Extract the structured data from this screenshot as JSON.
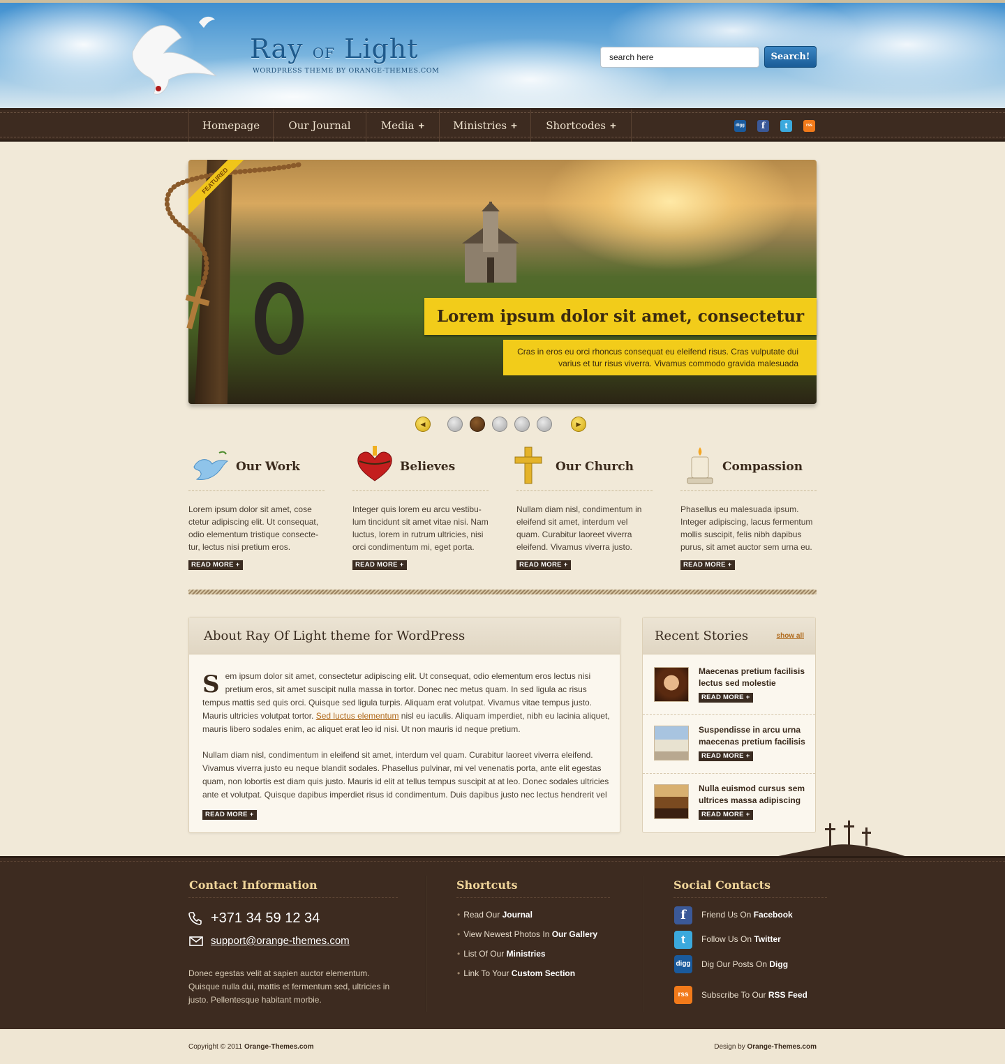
{
  "header": {
    "logo_ray": "Ray",
    "logo_of": "of",
    "logo_light": "Light",
    "logo_subtitle": "WORDPRESS THEME BY ORANGE-THEMES.COM",
    "search_placeholder": "search here",
    "search_value": "search here",
    "search_button": "Search!"
  },
  "nav": {
    "items": [
      {
        "label": "Homepage",
        "has_sub": false
      },
      {
        "label": "Our Journal",
        "has_sub": false
      },
      {
        "label": "Media",
        "has_sub": true
      },
      {
        "label": "Ministries",
        "has_sub": true
      },
      {
        "label": "Shortcodes",
        "has_sub": true
      }
    ],
    "plus": "+",
    "social": [
      {
        "icon": "digg-icon",
        "text": "digg",
        "color": "#1a5a9c"
      },
      {
        "icon": "facebook-icon",
        "text": "f",
        "color": "#3b5998"
      },
      {
        "icon": "twitter-icon",
        "text": "t",
        "color": "#3ba9dd"
      },
      {
        "icon": "rss-icon",
        "text": "rss",
        "color": "#f27a1a"
      }
    ]
  },
  "slider": {
    "badge": "FEATURED",
    "title": "Lorem ipsum dolor sit amet, consectetur",
    "description": "Cras in eros eu orci rhoncus consequat eu eleifend risus. Cras vulputate dui varius et tur risus viverra. Vivamus commodo gravida malesuada",
    "prev_icon": "◀",
    "next_icon": "▶",
    "dots": 5,
    "active_dot": 2
  },
  "features": [
    {
      "title": "Our Work",
      "icon": "dove-icon",
      "text": "Lorem ipsum dolor sit amet, cose ctetur adipiscing elit. Ut consequat, odio elementum tristique consecte-tur, lectus nisi pretium eros.",
      "read_more": "READ MORE +"
    },
    {
      "title": "Believes",
      "icon": "sacred-heart-icon",
      "text": "Integer quis lorem eu arcu vestibu-lum tincidunt sit amet vitae nisi. Nam luctus, lorem in rutrum ultricies, nisi orci condimentum mi, eget porta.",
      "read_more": "READ MORE +"
    },
    {
      "title": "Our Church",
      "icon": "cross-icon",
      "text": "Nullam diam nisl, condimentum in eleifend sit amet, interdum vel quam. Curabitur laoreet viverra eleifend. Vivamus viverra justo.",
      "read_more": "READ MORE +"
    },
    {
      "title": "Compassion",
      "icon": "candle-icon",
      "text": "Phasellus eu malesuada ipsum. Integer adipiscing, lacus fermentum mollis suscipit, felis nibh dapibus purus, sit amet auctor sem urna eu.",
      "read_more": "READ MORE +"
    }
  ],
  "about": {
    "title": "About Ray Of Light theme for WordPress",
    "drop_cap": "S",
    "p1_a": "em ipsum dolor sit amet, consectetur adipiscing elit. Ut consequat, odio elementum eros lectus nisi pretium eros, sit amet suscipit nulla massa in tortor. Donec nec metus quam. In sed ligula ac risus tempus mattis sed quis orci. Quisque sed ligula turpis. Aliquam erat volutpat. Vivamus vitae tempus justo. Mauris ultricies volutpat tortor. ",
    "p1_link": "Sed luctus elementum",
    "p1_b": " nisl eu iaculis. Aliquam imperdiet, nibh eu lacinia aliquet, mauris libero sodales enim, ac aliquet erat leo id nisi. Ut non mauris id neque pretium.",
    "p2": "Nullam diam nisl, condimentum in eleifend sit amet, interdum vel quam. Curabitur laoreet viverra eleifend. Vivamus viverra justo eu neque blandit sodales. Phasellus pulvinar, mi vel venenatis porta, ante elit egestas quam, non lobortis est diam quis justo. Mauris id elit at tellus tempus suscipit at at leo. Donec sodales ultricies ante et volutpat. Quisque dapibus imperdiet risus id condimentum. Duis dapibus justo nec lectus hendrerit vel",
    "read_more": "READ MORE +"
  },
  "recent": {
    "title": "Recent Stories",
    "show_all": "show all",
    "stories": [
      {
        "title": "Maecenas pretium facilisis lectus sed molestie",
        "read_more": "READ MORE +",
        "thumb_color": "#7a3a1a"
      },
      {
        "title": "Suspendisse in arcu urna maecenas pretium facilisis",
        "read_more": "READ MORE +",
        "thumb_color": "#9ab4cf"
      },
      {
        "title": "Nulla euismod cursus sem ultrices massa adipiscing",
        "read_more": "READ MORE +",
        "thumb_color": "#8a5a30"
      }
    ]
  },
  "footer": {
    "contact": {
      "title": "Contact Information",
      "phone": "+371 34 59 12 34",
      "email": "support@orange-themes.com",
      "description": "Donec egestas velit at sapien auctor elementum. Quisque nulla dui, mattis et fermentum sed, ultricies in justo. Pellentesque habitant morbie."
    },
    "shortcuts": {
      "title": "Shortcuts",
      "items": [
        {
          "pre": "Read Our ",
          "bold": "Journal"
        },
        {
          "pre": "View Newest Photos In ",
          "bold": "Our Gallery"
        },
        {
          "pre": "List Of Our ",
          "bold": "Ministries"
        },
        {
          "pre": "Link To Your ",
          "bold": "Custom Section"
        }
      ]
    },
    "social": {
      "title": "Social Contacts",
      "items": [
        {
          "pre": "Friend Us On ",
          "bold": "Facebook",
          "icon": "facebook-icon",
          "glyph": "f",
          "color": "#3b5998"
        },
        {
          "pre": "Follow Us On ",
          "bold": "Twitter",
          "icon": "twitter-icon",
          "glyph": "t",
          "color": "#3ba9dd"
        },
        {
          "pre": "Dig Our Posts On ",
          "bold": "Digg",
          "icon": "digg-icon",
          "glyph": "digg",
          "color": "#1a5a9c"
        },
        {
          "pre": "Subscribe To Our  ",
          "bold": "RSS Feed",
          "icon": "rss-icon",
          "glyph": "rss",
          "color": "#f27a1a"
        }
      ]
    }
  },
  "bottom": {
    "copyright_pre": "Copyright © 2011 ",
    "copyright_bold": "Orange-Themes.com",
    "design_pre": "Design by ",
    "design_bold": "Orange-Themes.com"
  }
}
